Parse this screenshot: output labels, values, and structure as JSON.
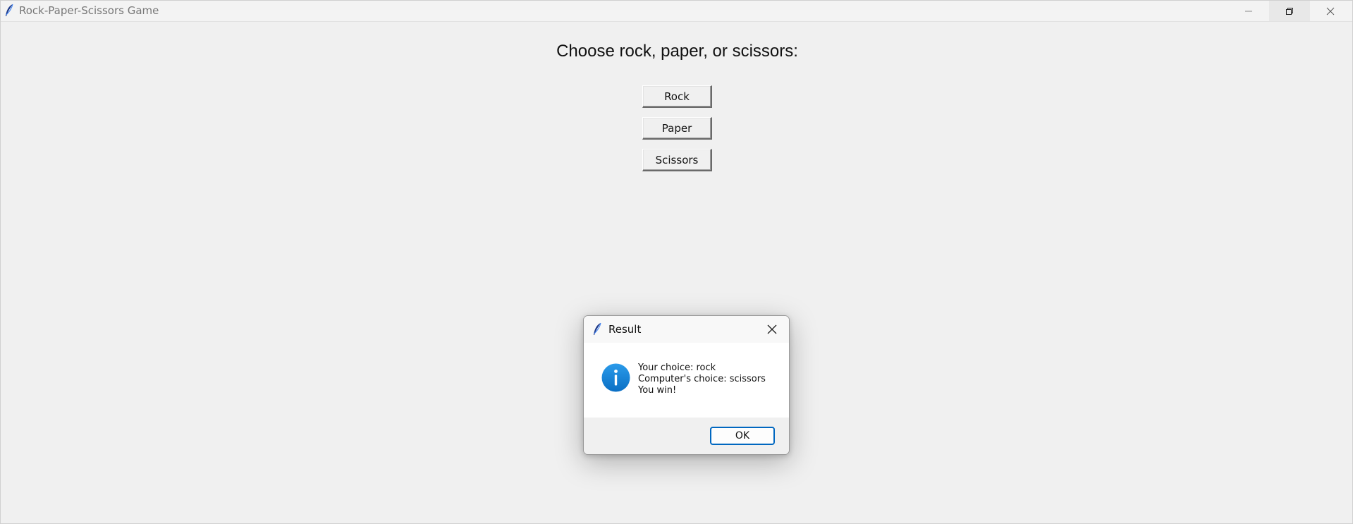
{
  "window": {
    "title": "Rock-Paper-Scissors Game",
    "controls": {
      "minimize_icon": "minimize-icon",
      "restore_icon": "restore-icon",
      "close_icon": "close-icon"
    }
  },
  "main": {
    "prompt": "Choose rock, paper, or scissors:",
    "buttons": {
      "rock": "Rock",
      "paper": "Paper",
      "scissors": "Scissors"
    }
  },
  "dialog": {
    "title": "Result",
    "icon": "info-icon",
    "message_lines": [
      "Your choice: rock",
      "Computer's choice: scissors",
      "You win!"
    ],
    "ok_label": "OK"
  },
  "colors": {
    "background": "#f0f0f0",
    "accent": "#0067c0",
    "info_icon": "#1a86d9"
  }
}
